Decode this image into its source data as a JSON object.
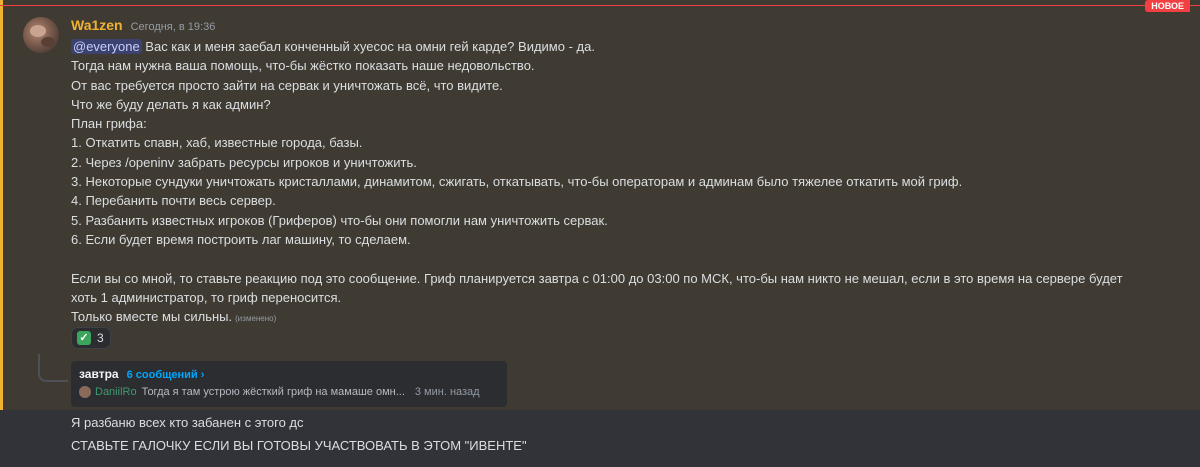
{
  "banner": {
    "new_label": "НОВОЕ"
  },
  "message": {
    "username": "Wa1zen",
    "timestamp": "Сегодня, в 19:36",
    "mention": "@everyone",
    "first_line_rest": " Вас как и меня заебал конченный хуесос на омни гей карде? Видимо - да.",
    "lines": [
      "Тогда нам нужна ваша помощь, что-бы жёстко показать наше недовольство.",
      "От вас требуется просто зайти на сервак и уничтожать всё, что видите.",
      "Что же буду делать я как админ?",
      "План грифа:",
      "1. Откатить спавн, хаб, известные города, базы.",
      "2. Через /openinv забрать ресурсы игроков и уничтожить.",
      "3. Некоторые сундуки уничтожать кристаллами, динамитом, сжигать, откатывать, что-бы операторам и админам было тяжелее откатить мой гриф.",
      "4. Перебанить почти весь сервер.",
      "5. Разбанить известных игроков (Гриферов) что-бы они помогли нам уничтожить сервак.",
      "6. Если будет время построить лаг машину, то сделаем.",
      "",
      "Если вы со мной, то ставьте реакцию под это сообщение. Гриф планируется завтра с 01:00 до 03:00 по МСК, что-бы нам никто не мешал, если в это время на сервере будет",
      "хоть 1 администратор, то гриф переносится."
    ],
    "last_line": "Только вместе мы сильны.",
    "edited_label": "(изменено)"
  },
  "reaction": {
    "emoji": "✓",
    "count": "3",
    "color": "#3ba55c"
  },
  "thread": {
    "name": "завтра",
    "count_label": "6 сообщений ›",
    "author": "DaniilRo",
    "preview": "Тогда я там устрою жёсткий гриф на мамаше омн...",
    "time": "3 мин. назад"
  },
  "followups": [
    "Я разбаню всех кто забанен с этого дс",
    "СТАВЬТЕ ГАЛОЧКУ ЕСЛИ ВЫ ГОТОВЫ УЧАСТВОВАТЬ В ЭТОМ \"ИВЕНТЕ\""
  ],
  "colors": {
    "accent": "#f0b232",
    "new_badge": "#f23f42",
    "link": "#00a8fc"
  }
}
